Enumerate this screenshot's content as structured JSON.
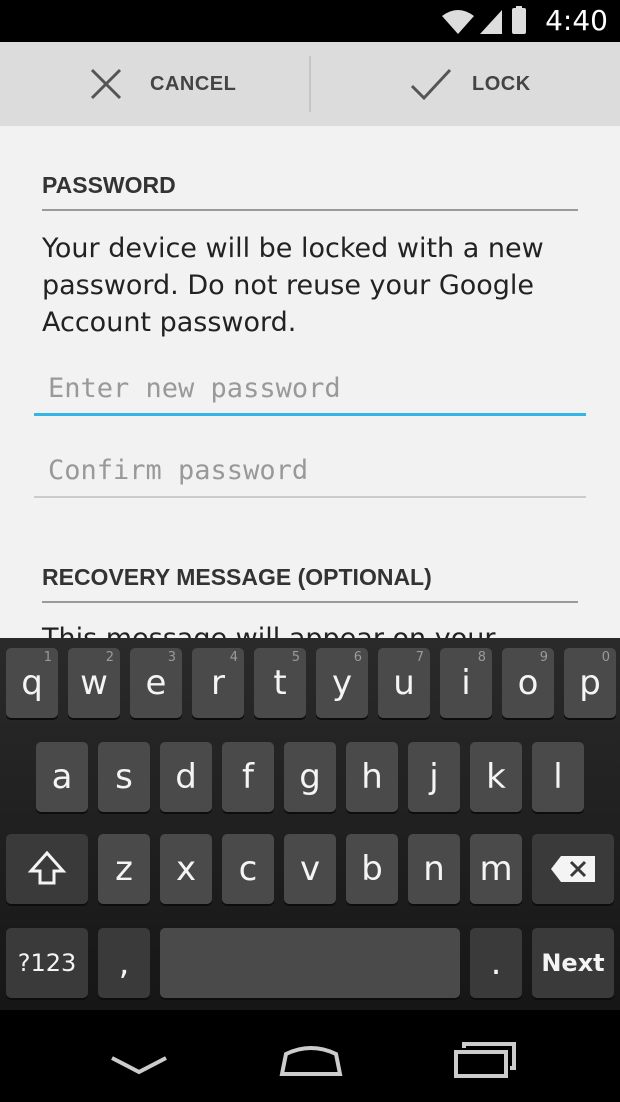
{
  "status": {
    "time": "4:40",
    "icons": [
      "wifi-icon",
      "signal-icon",
      "battery-icon"
    ]
  },
  "actionbar": {
    "cancel_label": "CANCEL",
    "lock_label": "LOCK"
  },
  "password_section": {
    "title": "PASSWORD",
    "description": "Your device will be locked with a new password. Do not reuse your Google Account password.",
    "new_password_placeholder": "Enter new password",
    "confirm_password_placeholder": "Confirm password"
  },
  "recovery_section": {
    "title": "RECOVERY MESSAGE (OPTIONAL)",
    "partial_text": "This message will appear on your"
  },
  "keyboard": {
    "row1": [
      {
        "k": "q",
        "h": "1"
      },
      {
        "k": "w",
        "h": "2"
      },
      {
        "k": "e",
        "h": "3"
      },
      {
        "k": "r",
        "h": "4"
      },
      {
        "k": "t",
        "h": "5"
      },
      {
        "k": "y",
        "h": "6"
      },
      {
        "k": "u",
        "h": "7"
      },
      {
        "k": "i",
        "h": "8"
      },
      {
        "k": "o",
        "h": "9"
      },
      {
        "k": "p",
        "h": "0"
      }
    ],
    "row2": [
      "a",
      "s",
      "d",
      "f",
      "g",
      "h",
      "j",
      "k",
      "l"
    ],
    "row3": [
      "z",
      "x",
      "c",
      "v",
      "b",
      "n",
      "m"
    ],
    "symbols_label": "?123",
    "comma_label": ",",
    "period_label": ".",
    "next_label": "Next"
  },
  "colors": {
    "accent": "#33b5e5"
  }
}
